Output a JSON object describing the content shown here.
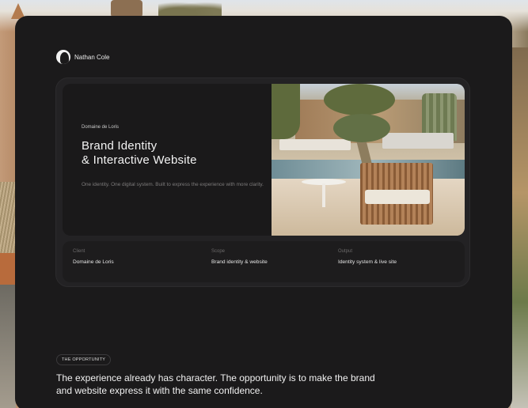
{
  "header": {
    "brand_name": "Nathan Cole"
  },
  "hero": {
    "eyebrow": "Domaine de Loris",
    "title_line1": "Brand Identity",
    "title_line2": "& Interactive Website",
    "subtitle": "One identity. One digital system. Built to express the experience with more clarity."
  },
  "meta": [
    {
      "label": "Client",
      "value": "Domaine de Loris"
    },
    {
      "label": "Scope",
      "value": "Brand identity & website"
    },
    {
      "label": "Output",
      "value": "Identity system & live site"
    }
  ],
  "opportunity": {
    "tag": "THE OPPORTUNITY",
    "statement": "The experience already has character. The opportunity is to make the brand and website express it with the same confidence."
  },
  "icons": {
    "brand_logo": "person-silhouette-icon"
  },
  "colors": {
    "panel": "#1b1a1b",
    "card": "#232224",
    "text_primary": "#f3f3f3",
    "text_muted": "#7d7b7b"
  }
}
